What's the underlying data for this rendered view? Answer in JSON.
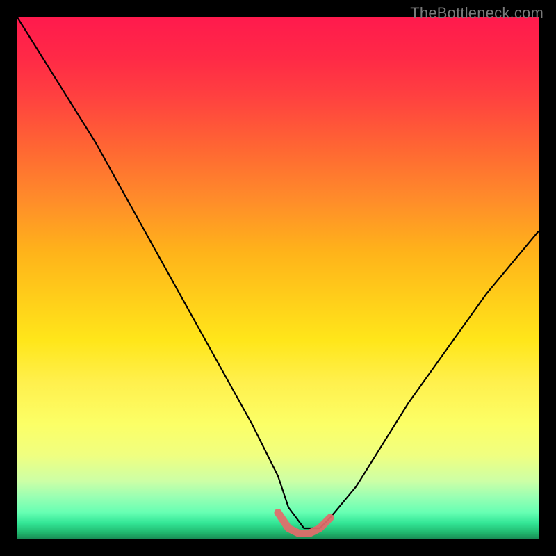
{
  "watermark": "TheBottleneck.com",
  "colors": {
    "frame": "#000000",
    "curve": "#000000",
    "floor_highlight": "#e46a6a",
    "gradient_top": "#ff1a4d",
    "gradient_mid": "#ffe61a",
    "gradient_bottom": "#198c55"
  },
  "chart_data": {
    "type": "line",
    "title": "",
    "xlabel": "",
    "ylabel": "",
    "xlim": [
      0,
      100
    ],
    "ylim": [
      0,
      100
    ],
    "series": [
      {
        "name": "bottleneck-curve",
        "x": [
          0,
          5,
          10,
          15,
          20,
          25,
          30,
          35,
          40,
          45,
          50,
          52,
          55,
          58,
          60,
          65,
          70,
          75,
          80,
          85,
          90,
          95,
          100
        ],
        "values": [
          100,
          92,
          84,
          76,
          67,
          58,
          49,
          40,
          31,
          22,
          12,
          6,
          2,
          2,
          4,
          10,
          18,
          26,
          33,
          40,
          47,
          53,
          59
        ]
      }
    ],
    "annotations": [
      {
        "name": "optimal-floor",
        "x": [
          50,
          52,
          54,
          56,
          58,
          60
        ],
        "values": [
          5,
          2,
          1,
          1,
          2,
          4
        ]
      }
    ]
  }
}
